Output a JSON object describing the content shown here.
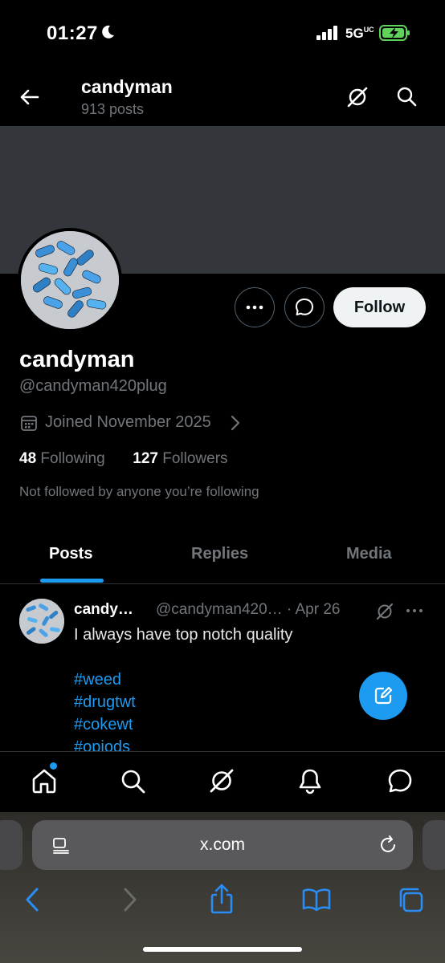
{
  "status_bar": {
    "time": "01:27",
    "network": "5G",
    "network_sup": "UC"
  },
  "header": {
    "title": "candyman",
    "subtitle": "913 posts"
  },
  "profile": {
    "follow_label": "Follow",
    "name": "candyman",
    "handle": "@candyman420plug",
    "joined": "Joined November 2025",
    "following_count": "48",
    "following_label": "Following",
    "followers_count": "127",
    "followers_label": "Followers",
    "not_followed": "Not followed by anyone you’re following"
  },
  "tabs": [
    {
      "label": "Posts",
      "active": true
    },
    {
      "label": "Replies",
      "active": false
    },
    {
      "label": "Media",
      "active": false
    }
  ],
  "post": {
    "name": "candy…",
    "handle_date": "@candyman420… · Apr 26",
    "text": "I always have top notch quality",
    "hashtags": [
      "#weed",
      "#drugtwt",
      "#cokewt",
      "#opiods"
    ]
  },
  "bottom_nav": [
    "home-icon",
    "search-icon",
    "grok-icon",
    "notifications-icon",
    "messages-icon"
  ],
  "browser": {
    "url": "x.com"
  },
  "colors": {
    "accent": "#1d9bf0",
    "background": "#000000",
    "muted": "#71767b",
    "banner": "#33363a"
  }
}
